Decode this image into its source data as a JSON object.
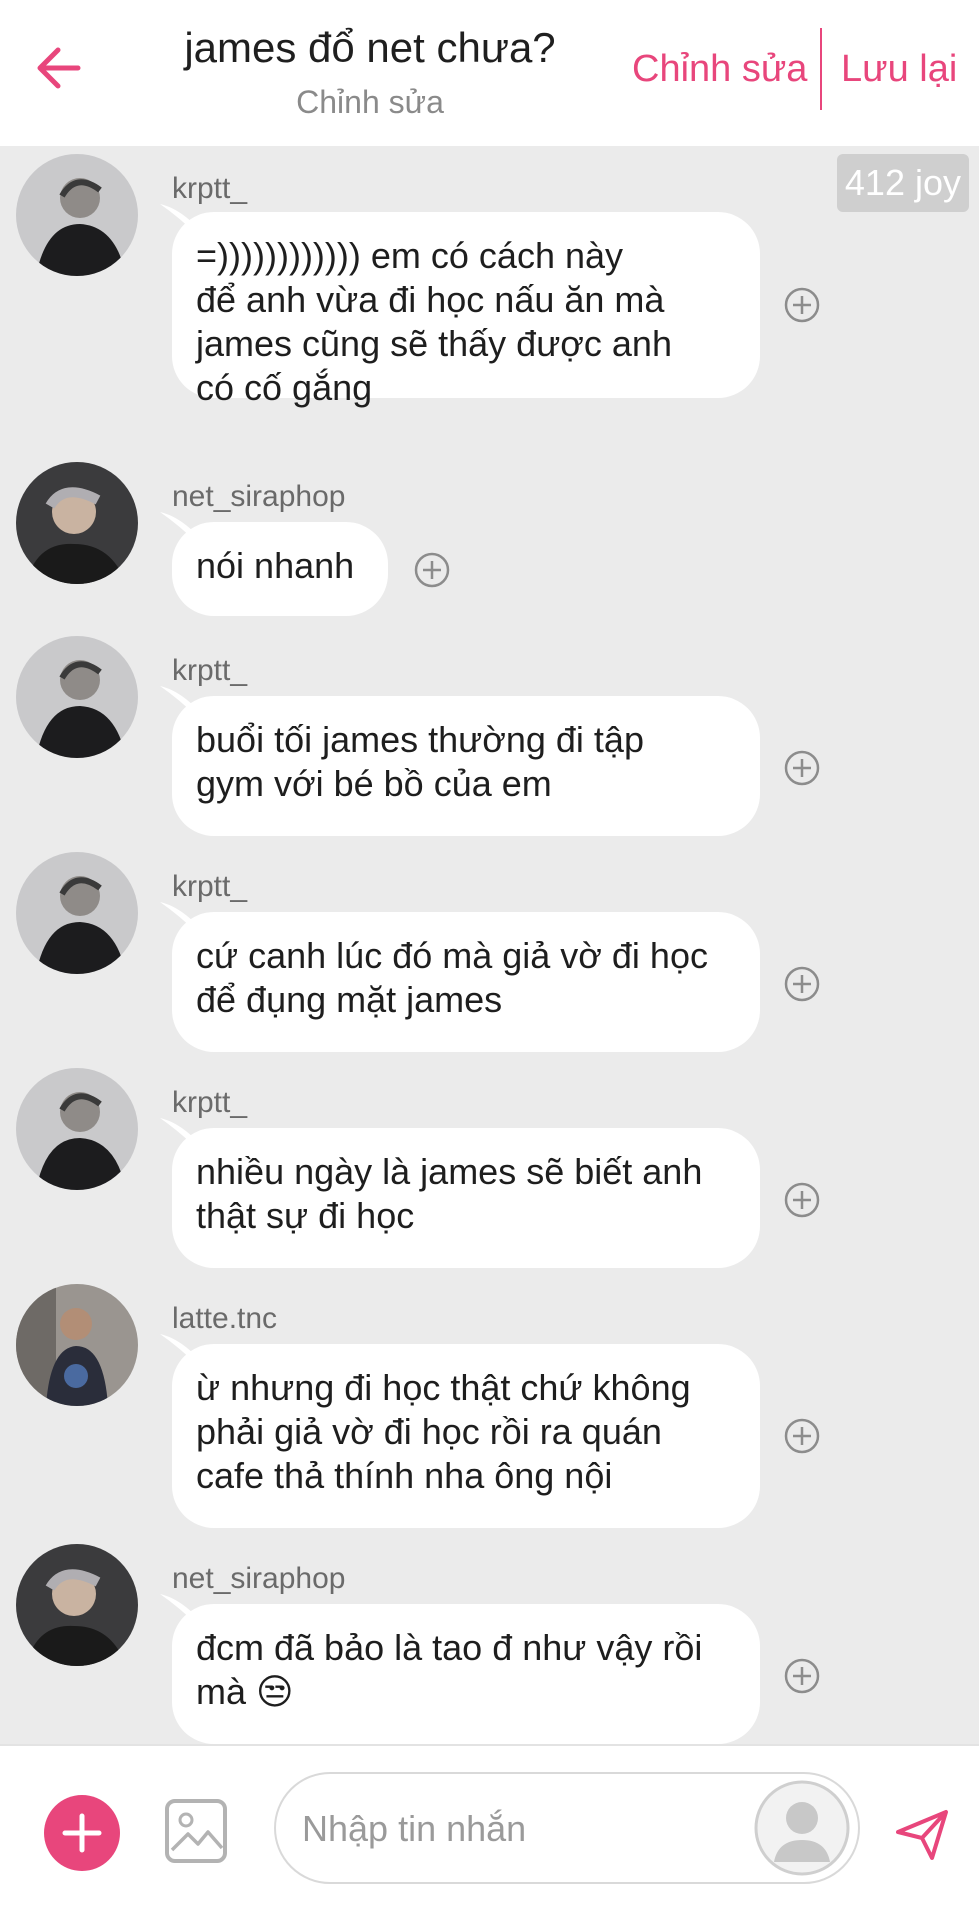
{
  "header": {
    "title": "james đổ net chưa?",
    "subtitle": "Chỉnh sửa",
    "edit_label": "Chỉnh sửa",
    "save_label": "Lưu lại"
  },
  "chat": {
    "joy_badge": "412 joy",
    "messages": [
      {
        "user": "krptt_",
        "lines": [
          "=)))))))))))) em có cách này",
          "để anh vừa đi học nấu ăn mà",
          "james cũng sẽ thấy được anh",
          "có cố gắng"
        ]
      },
      {
        "user": "net_siraphop",
        "lines": [
          "nói nhanh"
        ]
      },
      {
        "user": "krptt_",
        "lines": [
          "buổi tối james thường đi tập",
          "gym với bé bồ của em"
        ]
      },
      {
        "user": "krptt_",
        "lines": [
          "cứ canh lúc đó mà giả vờ đi học",
          "để đụng mặt james"
        ]
      },
      {
        "user": "krptt_",
        "lines": [
          "nhiều ngày là james sẽ biết anh",
          "thật sự đi học"
        ]
      },
      {
        "user": "latte.tnc",
        "lines": [
          "ừ nhưng đi học thật chứ không",
          "phải giả vờ đi học rồi ra quán",
          "cafe thả thính nha ông nội"
        ]
      },
      {
        "user": "net_siraphop",
        "lines": [
          "đcm đã bảo là tao đ như vậy rồi",
          "mà 😒"
        ]
      }
    ]
  },
  "composer": {
    "placeholder": "Nhập tin nhắn"
  },
  "colors": {
    "accent": "#e8467c",
    "chat_bg": "#ebebeb",
    "bubble": "#ffffff"
  },
  "icons": {
    "back": "arrow-left-icon",
    "add": "plus-circle-icon",
    "image": "image-icon",
    "react": "plus-circle-outline-icon",
    "send": "send-icon"
  }
}
